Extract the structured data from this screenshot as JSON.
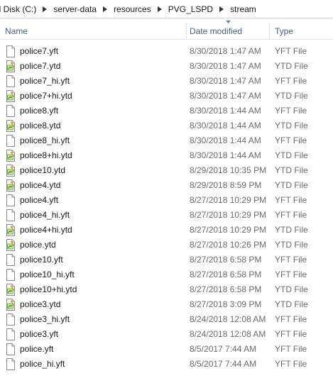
{
  "breadcrumb": [
    "al Disk (C:)",
    "server-data",
    "resources",
    "PVG_LSPD",
    "stream"
  ],
  "columns": {
    "name": "Name",
    "date": "Date modified",
    "type": "Type"
  },
  "files": [
    {
      "name": "police7.yft",
      "date": "8/30/2018 1:47 AM",
      "type": "YFT File",
      "icon": "yft-file-icon"
    },
    {
      "name": "police7.ytd",
      "date": "8/30/2018 1:47 AM",
      "type": "YTD File",
      "icon": "ytd-file-icon"
    },
    {
      "name": "police7_hi.yft",
      "date": "8/30/2018 1:47 AM",
      "type": "YFT File",
      "icon": "yft-file-icon"
    },
    {
      "name": "police7+hi.ytd",
      "date": "8/30/2018 1:47 AM",
      "type": "YTD File",
      "icon": "ytd-file-icon"
    },
    {
      "name": "police8.yft",
      "date": "8/30/2018 1:44 AM",
      "type": "YFT File",
      "icon": "yft-file-icon"
    },
    {
      "name": "police8.ytd",
      "date": "8/30/2018 1:44 AM",
      "type": "YTD File",
      "icon": "ytd-file-icon"
    },
    {
      "name": "police8_hi.yft",
      "date": "8/30/2018 1:44 AM",
      "type": "YFT File",
      "icon": "yft-file-icon"
    },
    {
      "name": "police8+hi.ytd",
      "date": "8/30/2018 1:44 AM",
      "type": "YTD File",
      "icon": "ytd-file-icon"
    },
    {
      "name": "police10.ytd",
      "date": "8/29/2018 10:35 PM",
      "type": "YTD File",
      "icon": "ytd-file-icon"
    },
    {
      "name": "police4.ytd",
      "date": "8/29/2018 8:59 PM",
      "type": "YTD File",
      "icon": "ytd-file-icon"
    },
    {
      "name": "police4.yft",
      "date": "8/27/2018 10:29 PM",
      "type": "YFT File",
      "icon": "yft-file-icon"
    },
    {
      "name": "police4_hi.yft",
      "date": "8/27/2018 10:29 PM",
      "type": "YFT File",
      "icon": "yft-file-icon"
    },
    {
      "name": "police4+hi.ytd",
      "date": "8/27/2018 10:29 PM",
      "type": "YTD File",
      "icon": "ytd-file-icon"
    },
    {
      "name": "police.ytd",
      "date": "8/27/2018 10:26 PM",
      "type": "YTD File",
      "icon": "ytd-file-icon"
    },
    {
      "name": "police10.yft",
      "date": "8/27/2018 6:58 PM",
      "type": "YFT File",
      "icon": "yft-file-icon"
    },
    {
      "name": "police10_hi.yft",
      "date": "8/27/2018 6:58 PM",
      "type": "YFT File",
      "icon": "yft-file-icon"
    },
    {
      "name": "police10+hi.ytd",
      "date": "8/27/2018 6:58 PM",
      "type": "YTD File",
      "icon": "ytd-file-icon"
    },
    {
      "name": "police3.ytd",
      "date": "8/27/2018 3:09 PM",
      "type": "YTD File",
      "icon": "ytd-file-icon"
    },
    {
      "name": "police3_hi.yft",
      "date": "8/24/2018 12:08 AM",
      "type": "YFT File",
      "icon": "yft-file-icon"
    },
    {
      "name": "police3.yft",
      "date": "8/24/2018 12:08 AM",
      "type": "YFT File",
      "icon": "yft-file-icon"
    },
    {
      "name": "police.yft",
      "date": "8/5/2017 7:44 AM",
      "type": "YFT File",
      "icon": "yft-file-icon"
    },
    {
      "name": "police_hi.yft",
      "date": "8/5/2017 7:44 AM",
      "type": "YFT File",
      "icon": "yft-file-icon"
    }
  ],
  "colors": {
    "header_text": "#4c607a",
    "meta_text": "#6d6d6d",
    "ytd_accent": "#5a9e1e"
  }
}
